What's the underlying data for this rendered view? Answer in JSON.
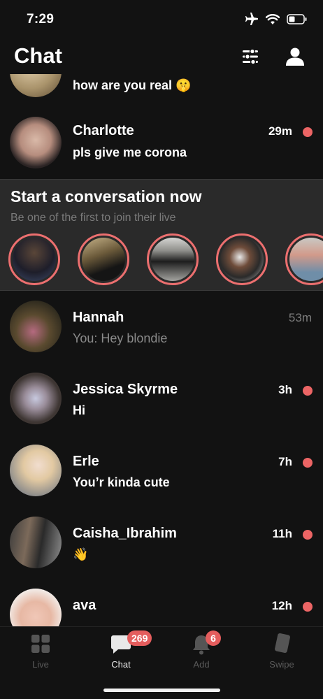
{
  "status_bar": {
    "time": "7:29"
  },
  "header": {
    "title": "Chat"
  },
  "chats_top": [
    {
      "name": "",
      "message": "how are you real 🤫",
      "time": "",
      "unread": false
    },
    {
      "name": "Charlotte",
      "message": "pls give me corona",
      "time": "29m",
      "unread": true
    }
  ],
  "promo": {
    "title": "Start a conversation now",
    "subtitle": "Be one of the first to join their live"
  },
  "chats": [
    {
      "name": "Hannah",
      "message": "You: Hey blondie",
      "time": "53m",
      "unread": false
    },
    {
      "name": "Jessica Skyrme",
      "message": "Hi",
      "time": "3h",
      "unread": true
    },
    {
      "name": "Erle",
      "message": "You’r kinda cute",
      "time": "7h",
      "unread": true
    },
    {
      "name": "Caisha_Ibrahim",
      "message": "👋",
      "time": "11h",
      "unread": true
    },
    {
      "name": "ava",
      "message": "",
      "time": "12h",
      "unread": true
    }
  ],
  "tabs": [
    {
      "label": "Live",
      "icon": "grid-icon"
    },
    {
      "label": "Chat",
      "icon": "chat-bubble-icon",
      "badge": "269"
    },
    {
      "label": "Add",
      "icon": "bell-icon",
      "badge": "6"
    },
    {
      "label": "Swipe",
      "icon": "card-icon"
    }
  ],
  "colors": {
    "background": "#121212",
    "unread_dot": "#ec6565",
    "badge": "#e45d5d",
    "promo_bg": "#2a2a2a",
    "story_ring": "#ec6f6f"
  }
}
